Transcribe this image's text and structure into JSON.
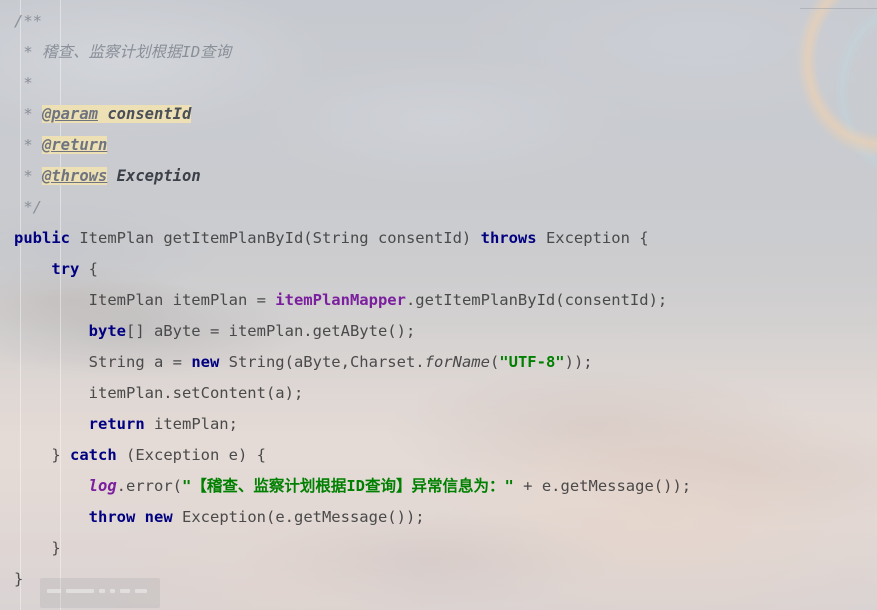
{
  "app": {
    "kind": "code-editor",
    "language": "Java",
    "theme_background_image": "sunset-sky-photo"
  },
  "colors": {
    "keyword": "#000080",
    "field": "#7b1f9e",
    "string": "#008000",
    "comment": "#8a8f98",
    "plain": "#4a4a4a",
    "tag_highlight": "#ece0b4",
    "background": "#b8bbc3"
  },
  "editor": {
    "indent_guides": [
      20,
      60
    ],
    "lines": [
      {
        "id": "l1",
        "indent": 0,
        "tokens": [
          {
            "t": "/**",
            "k": "comment"
          }
        ]
      },
      {
        "id": "l2",
        "indent": 0,
        "tokens": [
          {
            "t": " * ",
            "k": "comment"
          },
          {
            "t": "稽查、监察计划根据ID查询",
            "k": "comment"
          }
        ]
      },
      {
        "id": "l3",
        "indent": 0,
        "tokens": [
          {
            "t": " *",
            "k": "comment"
          }
        ]
      },
      {
        "id": "l4",
        "indent": 0,
        "tokens": [
          {
            "t": " * ",
            "k": "comment"
          },
          {
            "t": "@param",
            "k": "tag"
          },
          {
            "t": " ",
            "k": "tagval"
          },
          {
            "t": "consentId",
            "k": "tagval"
          }
        ]
      },
      {
        "id": "l5",
        "indent": 0,
        "tokens": [
          {
            "t": " * ",
            "k": "comment"
          },
          {
            "t": "@return",
            "k": "tag"
          }
        ]
      },
      {
        "id": "l6",
        "indent": 0,
        "tokens": [
          {
            "t": " * ",
            "k": "comment"
          },
          {
            "t": "@throws",
            "k": "tag"
          },
          {
            "t": " ",
            "k": "plain"
          },
          {
            "t": "Exception",
            "k": "tagvalpl"
          }
        ]
      },
      {
        "id": "l7",
        "indent": 0,
        "tokens": [
          {
            "t": " */",
            "k": "comment"
          }
        ]
      },
      {
        "id": "l8",
        "indent": 0,
        "tokens": [
          {
            "t": "public",
            "k": "kw"
          },
          {
            "t": " ItemPlan getItemPlanById(String consentId) ",
            "k": "plain"
          },
          {
            "t": "throws",
            "k": "kw"
          },
          {
            "t": " Exception {",
            "k": "plain"
          }
        ]
      },
      {
        "id": "l9",
        "indent": 1,
        "tokens": [
          {
            "t": "    ",
            "k": "plain"
          },
          {
            "t": "try",
            "k": "kw"
          },
          {
            "t": " {",
            "k": "plain"
          }
        ]
      },
      {
        "id": "l10",
        "indent": 2,
        "tokens": [
          {
            "t": "        ItemPlan itemPlan = ",
            "k": "plain"
          },
          {
            "t": "itemPlanMapper",
            "k": "field"
          },
          {
            "t": ".getItemPlanById(consentId);",
            "k": "plain"
          }
        ]
      },
      {
        "id": "l11",
        "indent": 2,
        "tokens": [
          {
            "t": "        ",
            "k": "plain"
          },
          {
            "t": "byte",
            "k": "kw"
          },
          {
            "t": "[] aByte = itemPlan.getAByte();",
            "k": "plain"
          }
        ]
      },
      {
        "id": "l12",
        "indent": 2,
        "tokens": [
          {
            "t": "        String a = ",
            "k": "plain"
          },
          {
            "t": "new",
            "k": "kw"
          },
          {
            "t": " String(aByte,Charset.",
            "k": "plain"
          },
          {
            "t": "forName",
            "k": "italic"
          },
          {
            "t": "(",
            "k": "plain"
          },
          {
            "t": "\"UTF-8\"",
            "k": "string"
          },
          {
            "t": "));",
            "k": "plain"
          }
        ]
      },
      {
        "id": "l13",
        "indent": 2,
        "tokens": [
          {
            "t": "        itemPlan.setContent(a);",
            "k": "plain"
          }
        ]
      },
      {
        "id": "l14",
        "indent": 2,
        "tokens": [
          {
            "t": "        ",
            "k": "plain"
          },
          {
            "t": "return",
            "k": "kw"
          },
          {
            "t": " itemPlan;",
            "k": "plain"
          }
        ]
      },
      {
        "id": "l15",
        "indent": 1,
        "tokens": [
          {
            "t": "    } ",
            "k": "plain"
          },
          {
            "t": "catch",
            "k": "kw"
          },
          {
            "t": " (Exception e) {",
            "k": "plain"
          }
        ]
      },
      {
        "id": "l16",
        "indent": 2,
        "tokens": [
          {
            "t": "        ",
            "k": "plain"
          },
          {
            "t": "log",
            "k": "static"
          },
          {
            "t": ".error(",
            "k": "plain"
          },
          {
            "t": "\"【稽查、监察计划根据ID查询】异常信息为：\"",
            "k": "string"
          },
          {
            "t": " + e.getMessage());",
            "k": "plain"
          }
        ]
      },
      {
        "id": "l17",
        "indent": 2,
        "tokens": [
          {
            "t": "        ",
            "k": "plain"
          },
          {
            "t": "throw",
            "k": "kw"
          },
          {
            "t": " ",
            "k": "plain"
          },
          {
            "t": "new",
            "k": "kw"
          },
          {
            "t": " Exception(e.getMessage());",
            "k": "plain"
          }
        ]
      },
      {
        "id": "l18",
        "indent": 1,
        "tokens": [
          {
            "t": "    }",
            "k": "plain"
          }
        ]
      },
      {
        "id": "l19",
        "indent": 0,
        "tokens": [
          {
            "t": "}",
            "k": "plain"
          }
        ]
      }
    ]
  }
}
